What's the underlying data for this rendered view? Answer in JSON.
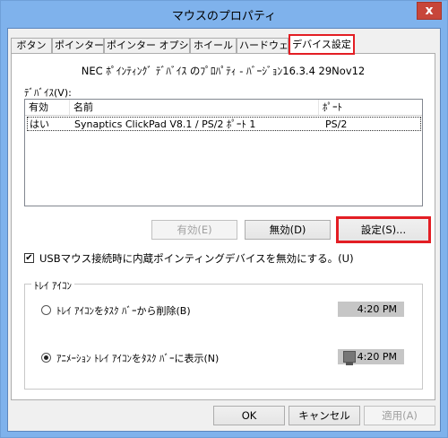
{
  "window": {
    "title": "マウスのプロパティ",
    "close_glyph": "x"
  },
  "tabs": [
    {
      "label": "ボタン"
    },
    {
      "label": "ポインター"
    },
    {
      "label": "ポインター オプション"
    },
    {
      "label": "ホイール"
    },
    {
      "label": "ハードウェア"
    },
    {
      "label": "デバイス設定"
    }
  ],
  "device": {
    "title": "NEC ﾎﾟｲﾝﾃｨﾝｸﾞ ﾃﾞﾊﾞｲｽ のﾌﾟﾛﾊﾟﾃｨ - ﾊﾞｰｼﾞｮﾝ16.3.4 29Nov12",
    "devices_label": "ﾃﾞﾊﾞｲｽ(V):",
    "columns": [
      "有効",
      "名前",
      "ﾎﾟｰﾄ"
    ],
    "rows": [
      {
        "enabled": "はい",
        "name": "Synaptics ClickPad V8.1 / PS/2 ﾎﾟｰﾄ 1",
        "port": "PS/2"
      }
    ]
  },
  "buttons": {
    "enable": "有効(E)",
    "disable": "無効(D)",
    "settings": "設定(S)..."
  },
  "usb_option": {
    "label": "USBマウス接続時に内蔵ポインティングデバイスを無効にする。(U)",
    "checked": true,
    "check_glyph": "✔"
  },
  "tray": {
    "group_label": "ﾄﾚｲ ｱｲｺﾝ",
    "options": [
      {
        "label": "ﾄﾚｲ ｱｲｺﾝをﾀｽｸ ﾊﾞｰから削除(B)",
        "time": "4:20 PM",
        "selected": false
      },
      {
        "label": "ｱﾆﾒｰｼｮﾝ ﾄﾚｲ ｱｲｺﾝをﾀｽｸ ﾊﾞｰに表示(N)",
        "time": "4:20 PM",
        "selected": true
      }
    ]
  },
  "dialog_buttons": {
    "ok": "OK",
    "cancel": "キャンセル",
    "apply": "適用(A)"
  },
  "colors": {
    "highlight": "#e31e24",
    "titlebar": "#7fb2ec"
  }
}
